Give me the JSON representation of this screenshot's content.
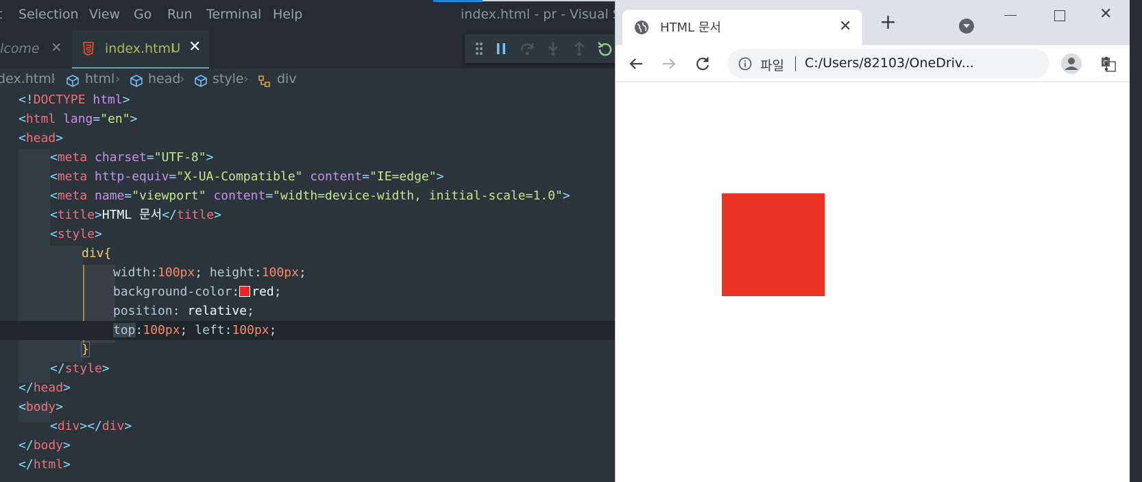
{
  "vscode": {
    "menu": [
      "t",
      "Selection",
      "View",
      "Go",
      "Run",
      "Terminal",
      "Help"
    ],
    "window_title": "index.html - pr - Visual Studio",
    "tabs": {
      "welcome": "lcome",
      "index": "index.html",
      "index_status": "U"
    },
    "breadcrumb": [
      "dex.html",
      "html",
      "head",
      "style",
      "div"
    ],
    "colors": {
      "accent_tab": "#a9bb57",
      "swatch": "#ee2222"
    }
  },
  "code": {
    "l1": {
      "a": "<!",
      "b": "DOCTYPE",
      "c": " html",
      "d": ">"
    },
    "l2": {
      "a": "<",
      "b": "html",
      "c": " lang",
      "d": "=",
      "e": "\"en\"",
      "f": ">"
    },
    "l3": {
      "a": "<",
      "b": "head",
      "c": ">"
    },
    "l4": {
      "a": "<",
      "b": "meta",
      "c": " charset",
      "d": "=",
      "e": "\"UTF-8\"",
      "f": ">"
    },
    "l5": {
      "a": "<",
      "b": "meta",
      "c": " http-equiv",
      "d": "=",
      "e": "\"X-UA-Compatible\"",
      "f": " content",
      "g": "=",
      "h": "\"IE=edge\"",
      "i": ">"
    },
    "l6": {
      "a": "<",
      "b": "meta",
      "c": " name",
      "d": "=",
      "e": "\"viewport\"",
      "f": " content",
      "g": "=",
      "h": "\"width=device-width, initial-scale=1.0\"",
      "i": ">"
    },
    "l7": {
      "a": "<",
      "b": "title",
      "c": ">",
      "d": "HTML 문서",
      "e": "</",
      "f": "title",
      "g": ">"
    },
    "l8": {
      "a": "<",
      "b": "style",
      "c": ">"
    },
    "l9": {
      "a": "div",
      "b": "{"
    },
    "l10": {
      "a": "width",
      "b": ":",
      "c": "100px",
      "d": "; ",
      "e": "height",
      "f": ":",
      "g": "100px",
      "h": ";"
    },
    "l11": {
      "a": "background-color",
      "b": ":",
      "c": "red",
      "d": ";"
    },
    "l12": {
      "a": "position",
      "b": ": ",
      "c": "relative",
      "d": ";"
    },
    "l13": {
      "a": "top",
      "b": ":",
      "c": "100px",
      "d": "; ",
      "e": "left",
      "f": ":",
      "g": "100px",
      "h": ";"
    },
    "l14": {
      "a": "}"
    },
    "l15": {
      "a": "</",
      "b": "style",
      "c": ">"
    },
    "l16": {
      "a": "</",
      "b": "head",
      "c": ">"
    },
    "l17": {
      "a": "<",
      "b": "body",
      "c": ">"
    },
    "l18": {
      "a": "<",
      "b": "div",
      "c": "></",
      "d": "div",
      "e": ">"
    },
    "l19": {
      "a": "</",
      "b": "body",
      "c": ">"
    },
    "l20": {
      "a": "</",
      "b": "html",
      "c": ">"
    }
  },
  "chrome": {
    "tab_title": "HTML 문서",
    "scheme_label": "파일",
    "url": "C:/Users/82103/OneDriv...",
    "rendered_div_color": "#ea3323"
  }
}
